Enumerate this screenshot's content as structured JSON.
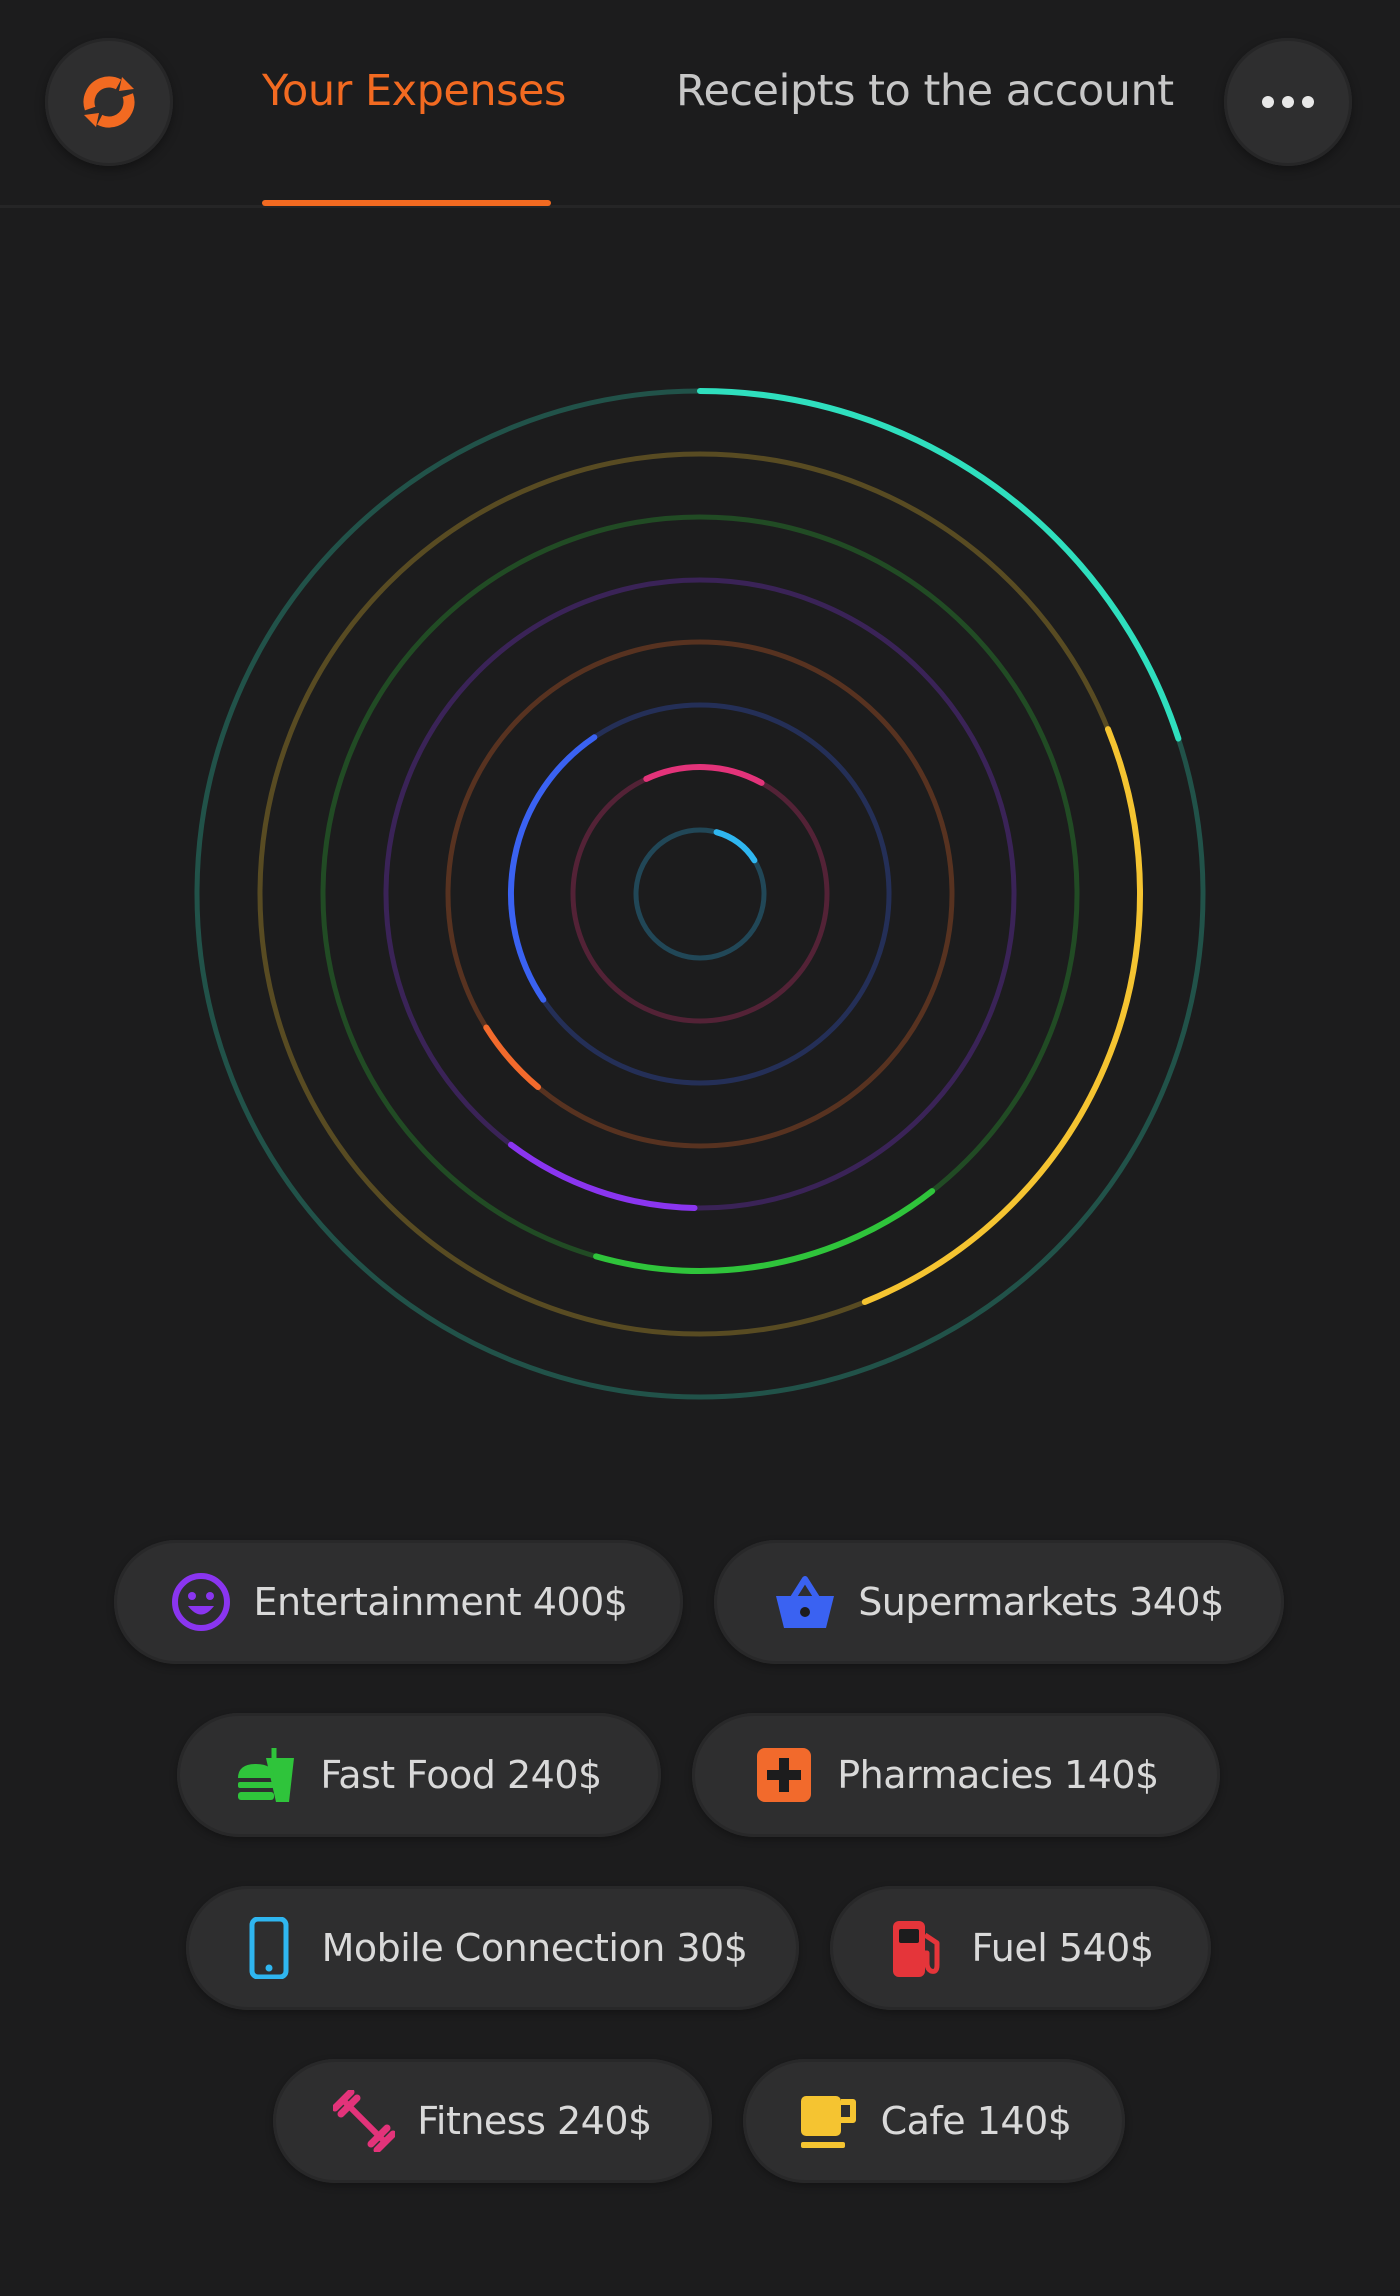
{
  "header": {
    "tabs": [
      {
        "label": "Your Expenses",
        "active": true
      },
      {
        "label": "Receipts to the account",
        "active": false
      }
    ],
    "accent_color": "#f26a21",
    "logo_icon": "refresh-logo-icon",
    "menu_icon": "more-dots-icon"
  },
  "chart_data": {
    "type": "radial",
    "rings": [
      {
        "color": "#2fdfbe",
        "progress": 0.2
      },
      {
        "color": "#f5c431",
        "progress": 0.25
      },
      {
        "color": "#2fc43b",
        "progress": 0.15
      },
      {
        "color": "#8a35f0",
        "progress": 0.1
      },
      {
        "color": "#f26a2c",
        "progress": 0.05
      },
      {
        "color": "#3a62f2",
        "progress": 0.25
      },
      {
        "color": "#e3337a",
        "progress": 0.15
      },
      {
        "color": "#2fb6f0",
        "progress": 0.12
      }
    ]
  },
  "categories": [
    {
      "label": "Entertainment 400$",
      "icon": "smiley-icon",
      "color": "#8a35f0"
    },
    {
      "label": "Supermarkets 340$",
      "icon": "basket-icon",
      "color": "#3a62f2"
    },
    {
      "label": "Fast Food 240$",
      "icon": "fast-food-icon",
      "color": "#2fc43b"
    },
    {
      "label": "Pharmacies 140$",
      "icon": "pharmacy-cross-icon",
      "color": "#f26a2c"
    },
    {
      "label": "Mobile Connection 30$",
      "icon": "phone-icon",
      "color": "#2fb6f0"
    },
    {
      "label": "Fuel 540$",
      "icon": "fuel-pump-icon",
      "color": "#e5353a"
    },
    {
      "label": "Fitness 240$",
      "icon": "dumbbell-icon",
      "color": "#e3337a"
    },
    {
      "label": "Cafe 140$",
      "icon": "coffee-cup-icon",
      "color": "#f5c431"
    }
  ]
}
